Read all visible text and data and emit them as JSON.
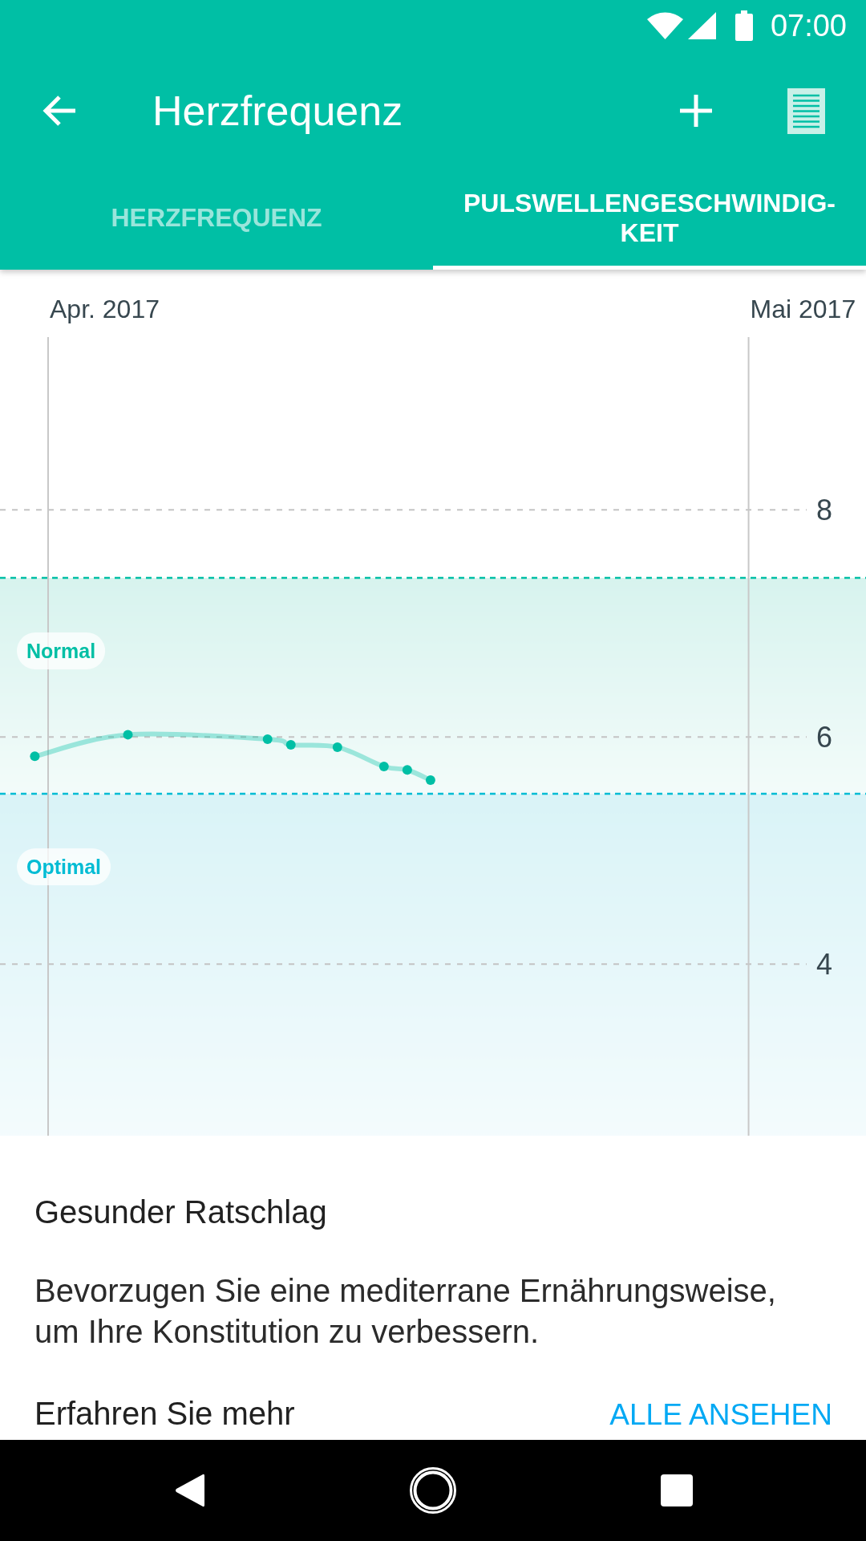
{
  "status_bar": {
    "time": "07:00"
  },
  "app_bar": {
    "title": "Herzfrequenz"
  },
  "tabs": [
    {
      "label": "HERZFREQUENZ",
      "selected": false
    },
    {
      "label": "PULSWELLENGESCHWINDIG-KEIT",
      "selected": true
    }
  ],
  "chart": {
    "chart_data": {
      "type": "line",
      "categories": [
        null,
        null,
        null,
        "Apr. 2017",
        null,
        null,
        null,
        null,
        null,
        null,
        null,
        null,
        null,
        null,
        null,
        null,
        null,
        null,
        null,
        null,
        null,
        null,
        null,
        null,
        null,
        null,
        null,
        null,
        null,
        null,
        null,
        null,
        null,
        "Mai 2017",
        null,
        null
      ],
      "series": [
        {
          "color": "#00bfa5",
          "marker": "o",
          "values": [
            5.83,
            null,
            null,
            null,
            6.02,
            null,
            null,
            null,
            null,
            null,
            5.98,
            5.93,
            null,
            5.91,
            null,
            5.74,
            5.71,
            5.62,
            null,
            null,
            null,
            null,
            null,
            null,
            null,
            null,
            null,
            null,
            null,
            null,
            null,
            null,
            null,
            null,
            null,
            null
          ]
        }
      ],
      "ylim": [
        2.49,
        9.52
      ],
      "yticks": [
        4,
        6,
        8
      ],
      "grid": true,
      "bands": [
        {
          "axis": "y",
          "from": 5.5,
          "to": 7.4,
          "color": "#d7f3ee"
        },
        {
          "axis": "y",
          "from": 2.49,
          "to": 5.5,
          "color": "#d9f3f7"
        }
      ],
      "ref_lines": [
        {
          "axis": "y",
          "value": 7.4,
          "color": "#00bfa5",
          "label": "Normal"
        },
        {
          "axis": "y",
          "value": 5.5,
          "color": "#00bcd4",
          "label": "Optimal"
        }
      ]
    }
  },
  "advice": {
    "title": "Gesunder Ratschlag",
    "text": "Bevorzugen Sie eine mediterrane Ernährungsweise, um Ihre Konstitution zu verbessern."
  },
  "learn_more": {
    "title": "Erfahren Sie mehr",
    "link": "ALLE ANSEHEN"
  }
}
